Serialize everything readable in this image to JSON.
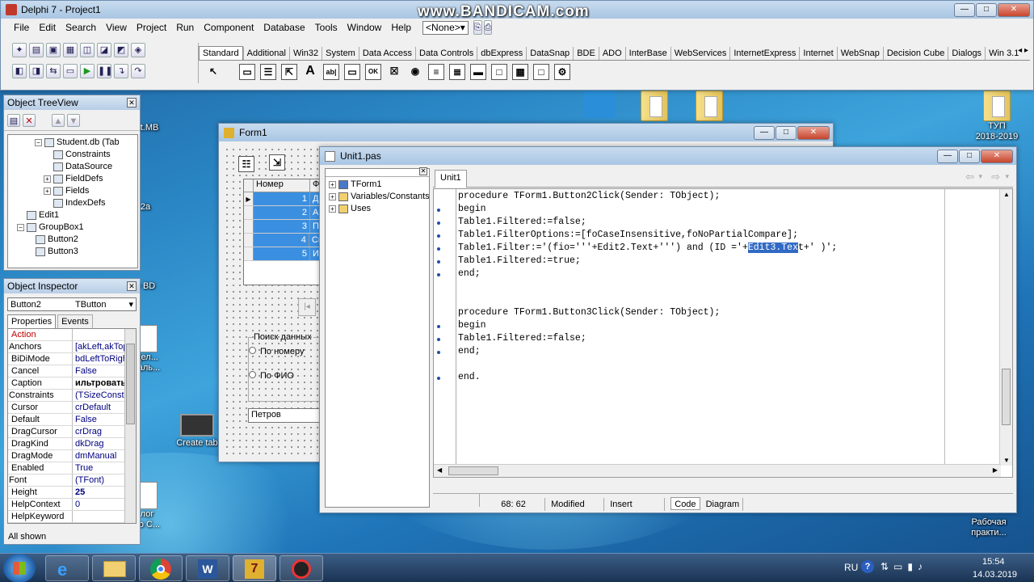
{
  "ide": {
    "title": "Delphi 7 - Project1",
    "watermark": "www.BANDICAM.com",
    "menu": [
      "File",
      "Edit",
      "Search",
      "View",
      "Project",
      "Run",
      "Component",
      "Database",
      "Tools",
      "Window",
      "Help"
    ],
    "config_value": "<None>",
    "palette_tabs": [
      "Standard",
      "Additional",
      "Win32",
      "System",
      "Data Access",
      "Data Controls",
      "dbExpress",
      "DataSnap",
      "BDE",
      "ADO",
      "InterBase",
      "WebServices",
      "InternetExpress",
      "Internet",
      "WebSnap",
      "Decision Cube",
      "Dialogs",
      "Win 3.1"
    ],
    "palette_icons": [
      "A",
      "ab|",
      "▭",
      "OK",
      "☒",
      "◉",
      "≡",
      "≣",
      "▬",
      "□",
      "▦"
    ]
  },
  "desktop": {
    "icons": [
      {
        "label": "nt.MB"
      },
      {
        "label": "2a"
      },
      {
        "label": "е BD"
      },
      {
        "label": "дел...\nталь..."
      },
      {
        "label": "Create tab"
      },
      {
        "label": "лог\nпо С..."
      },
      {
        "label": "ТУП\n2018-2019"
      },
      {
        "label": "Рабочая\nпракти..."
      }
    ]
  },
  "treeview": {
    "title": "Object TreeView",
    "items": [
      {
        "label": "Student.db (Tab",
        "indent": 3,
        "exp": "−"
      },
      {
        "label": "Constraints",
        "indent": 4,
        "exp": ""
      },
      {
        "label": "DataSource",
        "indent": 4,
        "exp": ""
      },
      {
        "label": "FieldDefs",
        "indent": 4,
        "exp": "+"
      },
      {
        "label": "Fields",
        "indent": 4,
        "exp": "+"
      },
      {
        "label": "IndexDefs",
        "indent": 4,
        "exp": ""
      },
      {
        "label": "Edit1",
        "indent": 1,
        "exp": ""
      },
      {
        "label": "GroupBox1",
        "indent": 1,
        "exp": "−"
      },
      {
        "label": "Button2",
        "indent": 2,
        "exp": ""
      },
      {
        "label": "Button3",
        "indent": 2,
        "exp": ""
      }
    ]
  },
  "inspector": {
    "title": "Object Inspector",
    "object": "Button2",
    "object_type": "TButton",
    "tabs": [
      "Properties",
      "Events"
    ],
    "rows": [
      {
        "name": "Action",
        "value": ""
      },
      {
        "name": "Anchors",
        "value": "[akLeft,akTop"
      },
      {
        "name": "BiDiMode",
        "value": "bdLeftToRight"
      },
      {
        "name": "Cancel",
        "value": "False"
      },
      {
        "name": "Caption",
        "value": "ильтровать"
      },
      {
        "name": "Constraints",
        "value": "(TSizeConstra"
      },
      {
        "name": "Cursor",
        "value": "crDefault"
      },
      {
        "name": "Default",
        "value": "False"
      },
      {
        "name": "DragCursor",
        "value": "crDrag"
      },
      {
        "name": "DragKind",
        "value": "dkDrag"
      },
      {
        "name": "DragMode",
        "value": "dmManual"
      },
      {
        "name": "Enabled",
        "value": "True"
      },
      {
        "name": "Font",
        "value": "(TFont)"
      },
      {
        "name": "Height",
        "value": "25"
      },
      {
        "name": "HelpContext",
        "value": "0"
      },
      {
        "name": "HelpKeyword",
        "value": ""
      }
    ],
    "footer": "All shown"
  },
  "form1": {
    "title": "Form1",
    "grid_header": [
      "Номер",
      "Ф"
    ],
    "grid_rows": [
      {
        "n": "1",
        "f": "Д"
      },
      {
        "n": "2",
        "f": "А"
      },
      {
        "n": "3",
        "f": "П"
      },
      {
        "n": "4",
        "f": "Си"
      },
      {
        "n": "5",
        "f": "И"
      }
    ],
    "group_title": "Поиск данных",
    "radio1": "По номеру",
    "radio2": "По ФИО",
    "edit_value": "Петров"
  },
  "editor": {
    "title": "Unit1.pas",
    "explorer": [
      {
        "label": "TForm1"
      },
      {
        "label": "Variables/Constants"
      },
      {
        "label": "Uses"
      }
    ],
    "tab": "Unit1",
    "lines": [
      {
        "pre": "procedure TForm1.Button2Click(Sender: TObject);",
        "sel": "",
        "post": "",
        "dot": false
      },
      {
        "pre": "begin",
        "sel": "",
        "post": "",
        "dot": true
      },
      {
        "pre": "Table1.Filtered:=false;",
        "sel": "",
        "post": "",
        "dot": true
      },
      {
        "pre": "Table1.FilterOptions:=[foCaseInsensitive,foNoPartialCompare];",
        "sel": "",
        "post": "",
        "dot": true
      },
      {
        "pre": "Table1.Filter:='(fio='''+Edit2.Text+''') and (ID ='+",
        "sel": "Edit3.Tex",
        "post": "t+' )';",
        "dot": true
      },
      {
        "pre": "Table1.Filtered:=true;",
        "sel": "",
        "post": "",
        "dot": true
      },
      {
        "pre": "end;",
        "sel": "",
        "post": "",
        "dot": true
      },
      {
        "pre": "",
        "sel": "",
        "post": "",
        "dot": false
      },
      {
        "pre": "",
        "sel": "",
        "post": "",
        "dot": false
      },
      {
        "pre": "procedure TForm1.Button3Click(Sender: TObject);",
        "sel": "",
        "post": "",
        "dot": false
      },
      {
        "pre": "begin",
        "sel": "",
        "post": "",
        "dot": true
      },
      {
        "pre": "Table1.Filtered:=false;",
        "sel": "",
        "post": "",
        "dot": true
      },
      {
        "pre": "end;",
        "sel": "",
        "post": "",
        "dot": true
      },
      {
        "pre": "",
        "sel": "",
        "post": "",
        "dot": false
      },
      {
        "pre": "end.",
        "sel": "",
        "post": "",
        "dot": true
      }
    ],
    "status_pos": "68: 62",
    "status_modified": "Modified",
    "status_insert": "Insert",
    "tabs_bottom": [
      "Code",
      "Diagram"
    ]
  },
  "taskbar": {
    "lang": "RU",
    "time": "15:54",
    "date": "14.03.2019"
  }
}
